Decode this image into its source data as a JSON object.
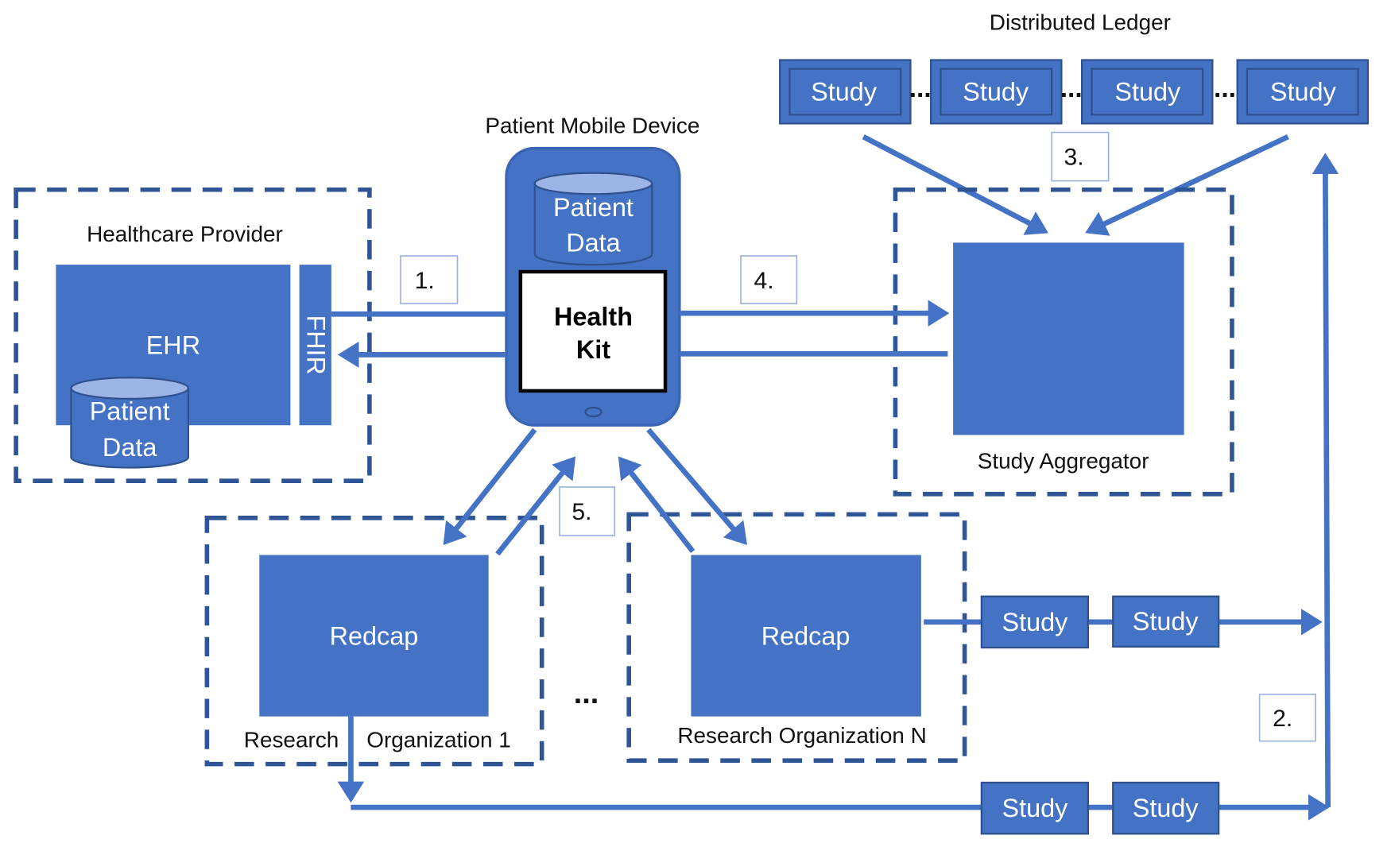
{
  "colors": {
    "primary": "#4472C4",
    "border": "#2F528F",
    "dashed": "#2F5597"
  },
  "ledger": {
    "title": "Distributed Ledger",
    "studies": [
      "Study",
      "Study",
      "Study",
      "Study"
    ],
    "ellipsis": "..."
  },
  "steps": {
    "s1": "1.",
    "s2": "2.",
    "s3": "3.",
    "s4": "4.",
    "s5": "5."
  },
  "mobile": {
    "title": "Patient Mobile Device",
    "db_line1": "Patient",
    "db_line2": "Data",
    "kit_line1": "Health",
    "kit_line2": "Kit"
  },
  "provider": {
    "title": "Healthcare Provider",
    "ehr": "EHR",
    "fhir": "FHIR",
    "db_line1": "Patient",
    "db_line2": "Data"
  },
  "aggregator": {
    "title": "Study Aggregator"
  },
  "org1": {
    "system": "Redcap",
    "label_a": "Research",
    "label_b": "Organization 1"
  },
  "orgN": {
    "system": "Redcap",
    "label": "Research Organization N"
  },
  "orgs_ellipsis": "...",
  "chains": {
    "upper": [
      "Study",
      "Study"
    ],
    "lower": [
      "Study",
      "Study"
    ]
  }
}
